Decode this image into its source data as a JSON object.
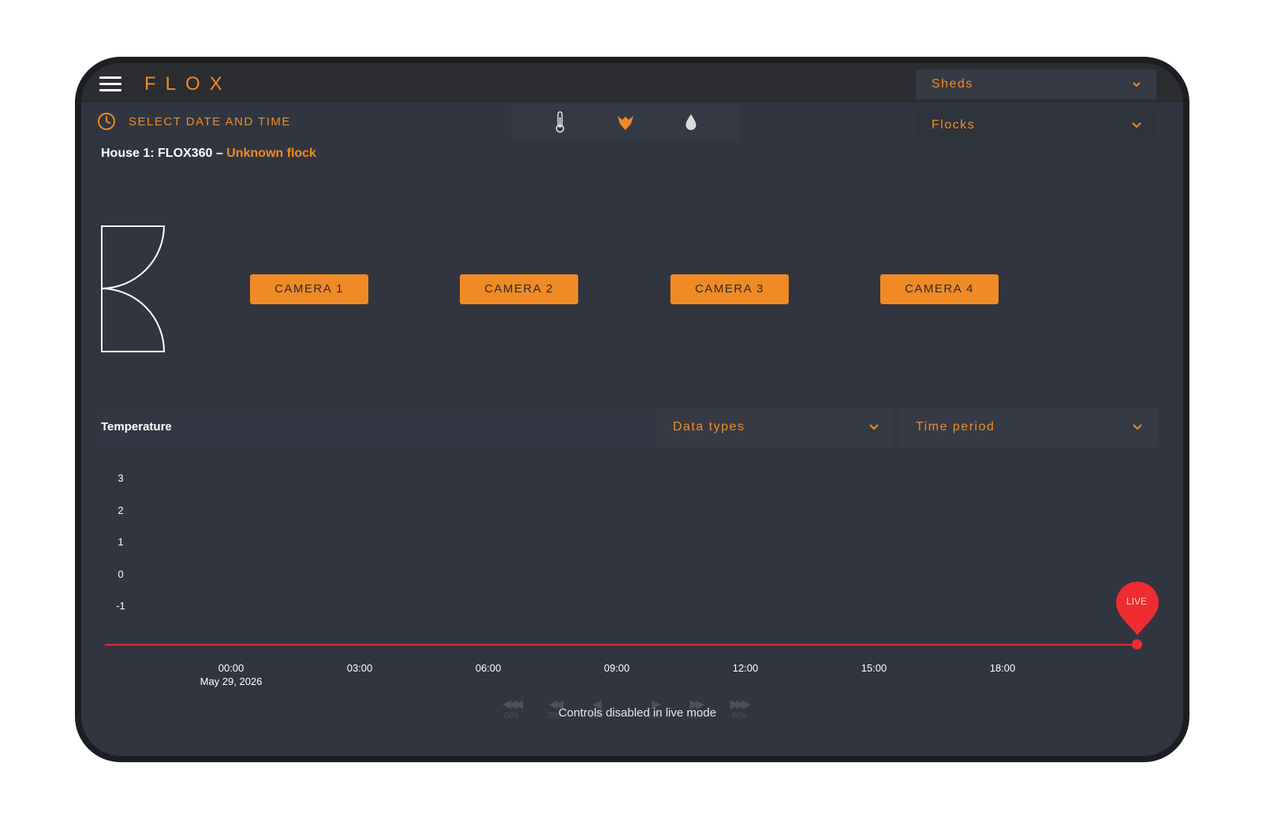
{
  "app": {
    "logo": "FLOX"
  },
  "header": {
    "sheds_label": "Sheds",
    "flocks_label": "Flocks",
    "datetime_label": "SELECT DATE AND TIME"
  },
  "icon_bar": {
    "items": [
      "thermometer-icon",
      "bird-icon",
      "water-drop-icon"
    ],
    "active": "bird-icon"
  },
  "house": {
    "name": "House 1: FLOX360 –",
    "flock": "Unknown flock"
  },
  "cameras": [
    "CAMERA 1",
    "CAMERA 2",
    "CAMERA 3",
    "CAMERA 4"
  ],
  "temperature": {
    "title": "Temperature",
    "data_types_label": "Data types",
    "time_period_label": "Time period",
    "y_ticks": [
      "3",
      "2",
      "1",
      "0",
      "-1"
    ],
    "x_ticks": [
      "00:00",
      "03:00",
      "06:00",
      "09:00",
      "12:00",
      "15:00",
      "18:00"
    ],
    "x_date": "May 29, 2026",
    "live_label": "LIVE"
  },
  "playback": {
    "buttons": [
      "60s",
      "30s",
      "10s",
      "10s",
      "30s",
      "60s"
    ],
    "message": "Controls disabled in live mode"
  },
  "colors": {
    "accent": "#f08a24",
    "live": "#ee2c32",
    "background": "#313540",
    "topbar": "#2b2d31"
  }
}
